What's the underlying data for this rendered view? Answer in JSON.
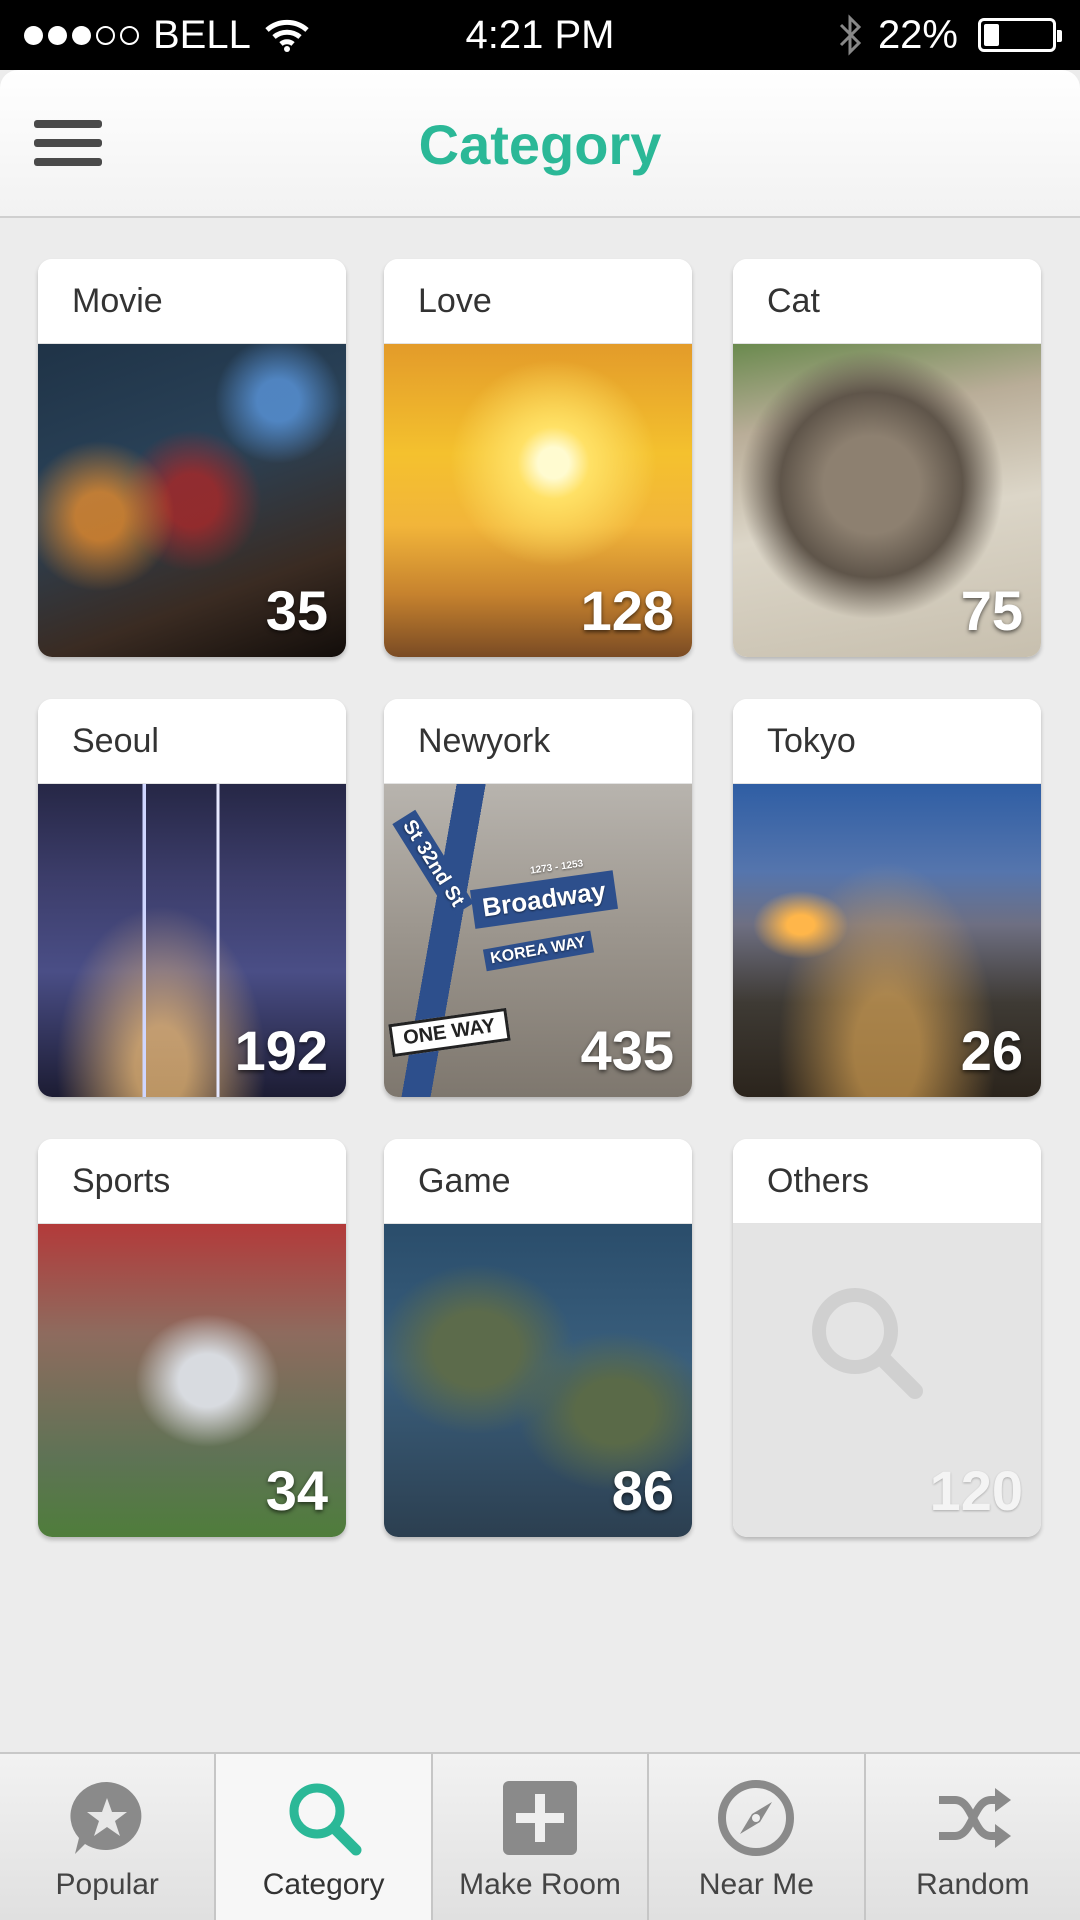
{
  "status_bar": {
    "carrier": "BELL",
    "time": "4:21 PM",
    "battery": "22%",
    "battery_level": 0.22,
    "signal_bars": 3,
    "signal_total": 5
  },
  "header": {
    "title": "Category",
    "title_color": "#2bb897"
  },
  "categories": [
    {
      "label": "Movie",
      "count": "35"
    },
    {
      "label": "Love",
      "count": "128"
    },
    {
      "label": "Cat",
      "count": "75"
    },
    {
      "label": "Seoul",
      "count": "192"
    },
    {
      "label": "Newyork",
      "count": "435",
      "image_text": [
        "St 32nd St",
        "Broadway",
        "1273 - 1253",
        "KOREA WAY",
        "ONE WAY"
      ]
    },
    {
      "label": "Tokyo",
      "count": "26"
    },
    {
      "label": "Sports",
      "count": "34"
    },
    {
      "label": "Game",
      "count": "86"
    },
    {
      "label": "Others",
      "count": "120",
      "icon": "search-icon"
    }
  ],
  "tab_bar": {
    "accent_color": "#2bb897",
    "tabs": [
      {
        "label": "Popular",
        "icon": "star-bubble-icon",
        "active": false
      },
      {
        "label": "Category",
        "icon": "search-icon",
        "active": true
      },
      {
        "label": "Make Room",
        "icon": "plus-icon",
        "active": false
      },
      {
        "label": "Near Me",
        "icon": "compass-icon",
        "active": false
      },
      {
        "label": "Random",
        "icon": "shuffle-icon",
        "active": false
      }
    ]
  }
}
